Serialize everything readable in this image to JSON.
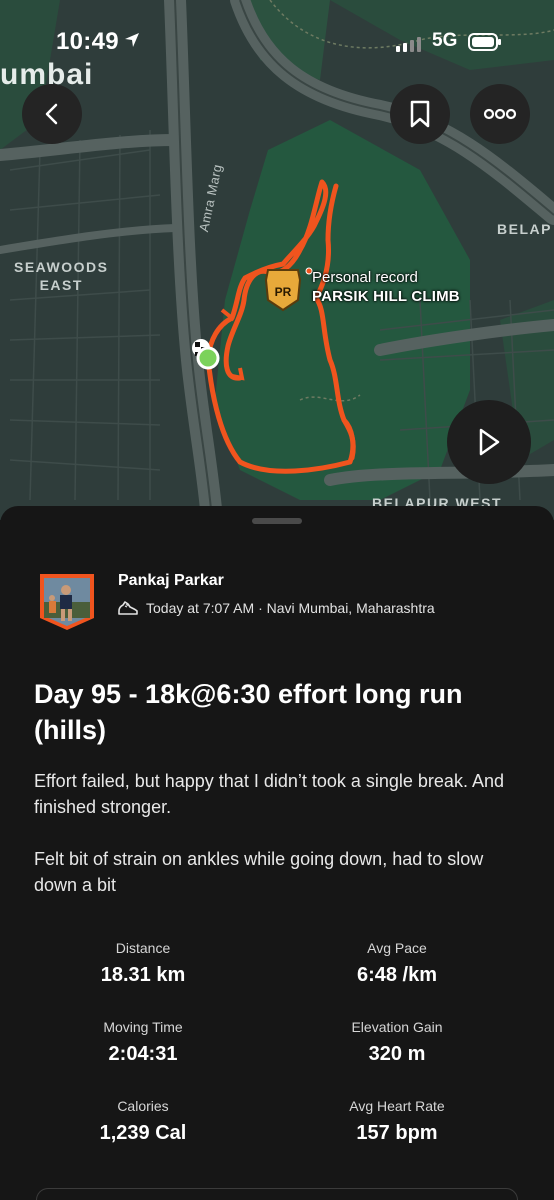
{
  "status": {
    "time": "10:49",
    "network": "5G"
  },
  "map": {
    "labels": {
      "city": "umbai",
      "seawoods": "SEAWOODS\nEAST",
      "belap": "BELAP",
      "belapur_west": "BELAPUR WEST",
      "road": "Amra Marg"
    },
    "pr": {
      "badge": "PR",
      "title": "Personal record",
      "segment": "PARSIK HILL CLIMB"
    },
    "colors": {
      "route": "#f0541e",
      "park": "#24583f",
      "land": "#2f3d3b",
      "road": "#4c5856"
    }
  },
  "activity": {
    "athlete": "Pankaj Parkar",
    "meta": "Today at 7:07 AM · Navi Mumbai, Maharashtra",
    "title": "Day 95 - 18k@6:30 effort long run (hills)",
    "description": [
      "Effort failed, but happy that I didn’t took a single break. And finished stronger.",
      "Felt bit of strain on ankles while going down, had to slow down a bit"
    ],
    "stats": [
      {
        "label": "Distance",
        "value": "18.31 km"
      },
      {
        "label": "Avg Pace",
        "value": "6:48 /km"
      },
      {
        "label": "Moving Time",
        "value": "2:04:31"
      },
      {
        "label": "Elevation Gain",
        "value": "320 m"
      },
      {
        "label": "Calories",
        "value": "1,239 Cal"
      },
      {
        "label": "Avg Heart Rate",
        "value": "157 bpm"
      }
    ]
  }
}
